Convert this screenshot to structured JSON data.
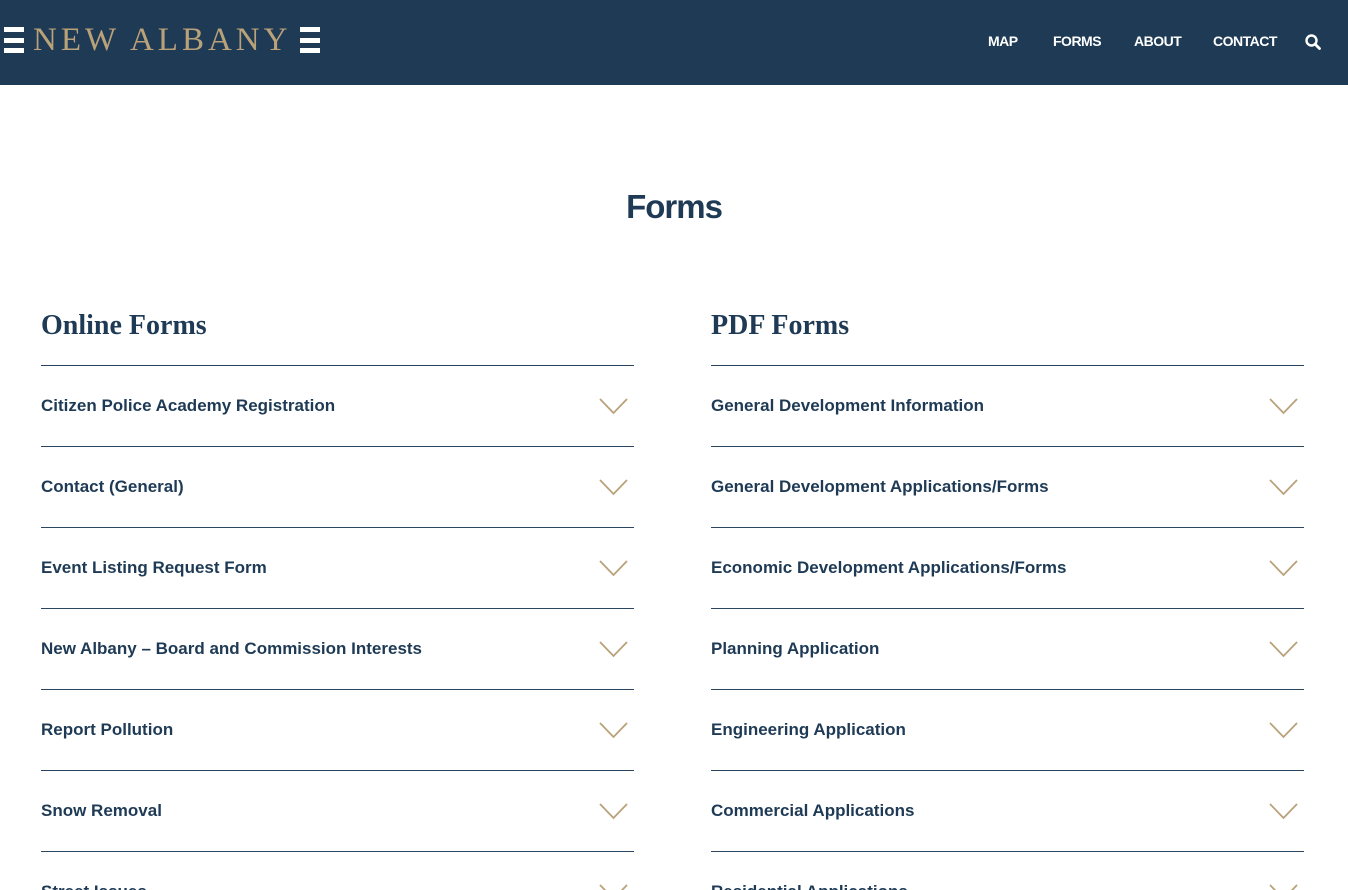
{
  "header": {
    "logo_text": "NEW ALBANY",
    "nav": [
      {
        "label": "MAP"
      },
      {
        "label": "FORMS"
      },
      {
        "label": "ABOUT"
      },
      {
        "label": "CONTACT"
      }
    ],
    "search_icon": "search-icon"
  },
  "page": {
    "title": "Forms"
  },
  "online_forms": {
    "heading": "Online Forms",
    "items": [
      {
        "label": "Citizen Police Academy Registration"
      },
      {
        "label": "Contact (General)"
      },
      {
        "label": "Event Listing Request Form"
      },
      {
        "label": "New Albany – Board and Commission Interests"
      },
      {
        "label": "Report Pollution"
      },
      {
        "label": "Snow Removal"
      },
      {
        "label": "Street Issues"
      }
    ]
  },
  "pdf_forms": {
    "heading": "PDF Forms",
    "items": [
      {
        "label": "General Development Information"
      },
      {
        "label": "General Development Applications/Forms"
      },
      {
        "label": "Economic Development Applications/Forms"
      },
      {
        "label": "Planning Application"
      },
      {
        "label": "Engineering Application"
      },
      {
        "label": "Commercial Applications"
      },
      {
        "label": "Residential Applications"
      }
    ]
  },
  "colors": {
    "header_bg": "#1e3a55",
    "logo_gold": "#b9a179",
    "text_navy": "#1e3a55",
    "chevron": "#b9a179"
  }
}
